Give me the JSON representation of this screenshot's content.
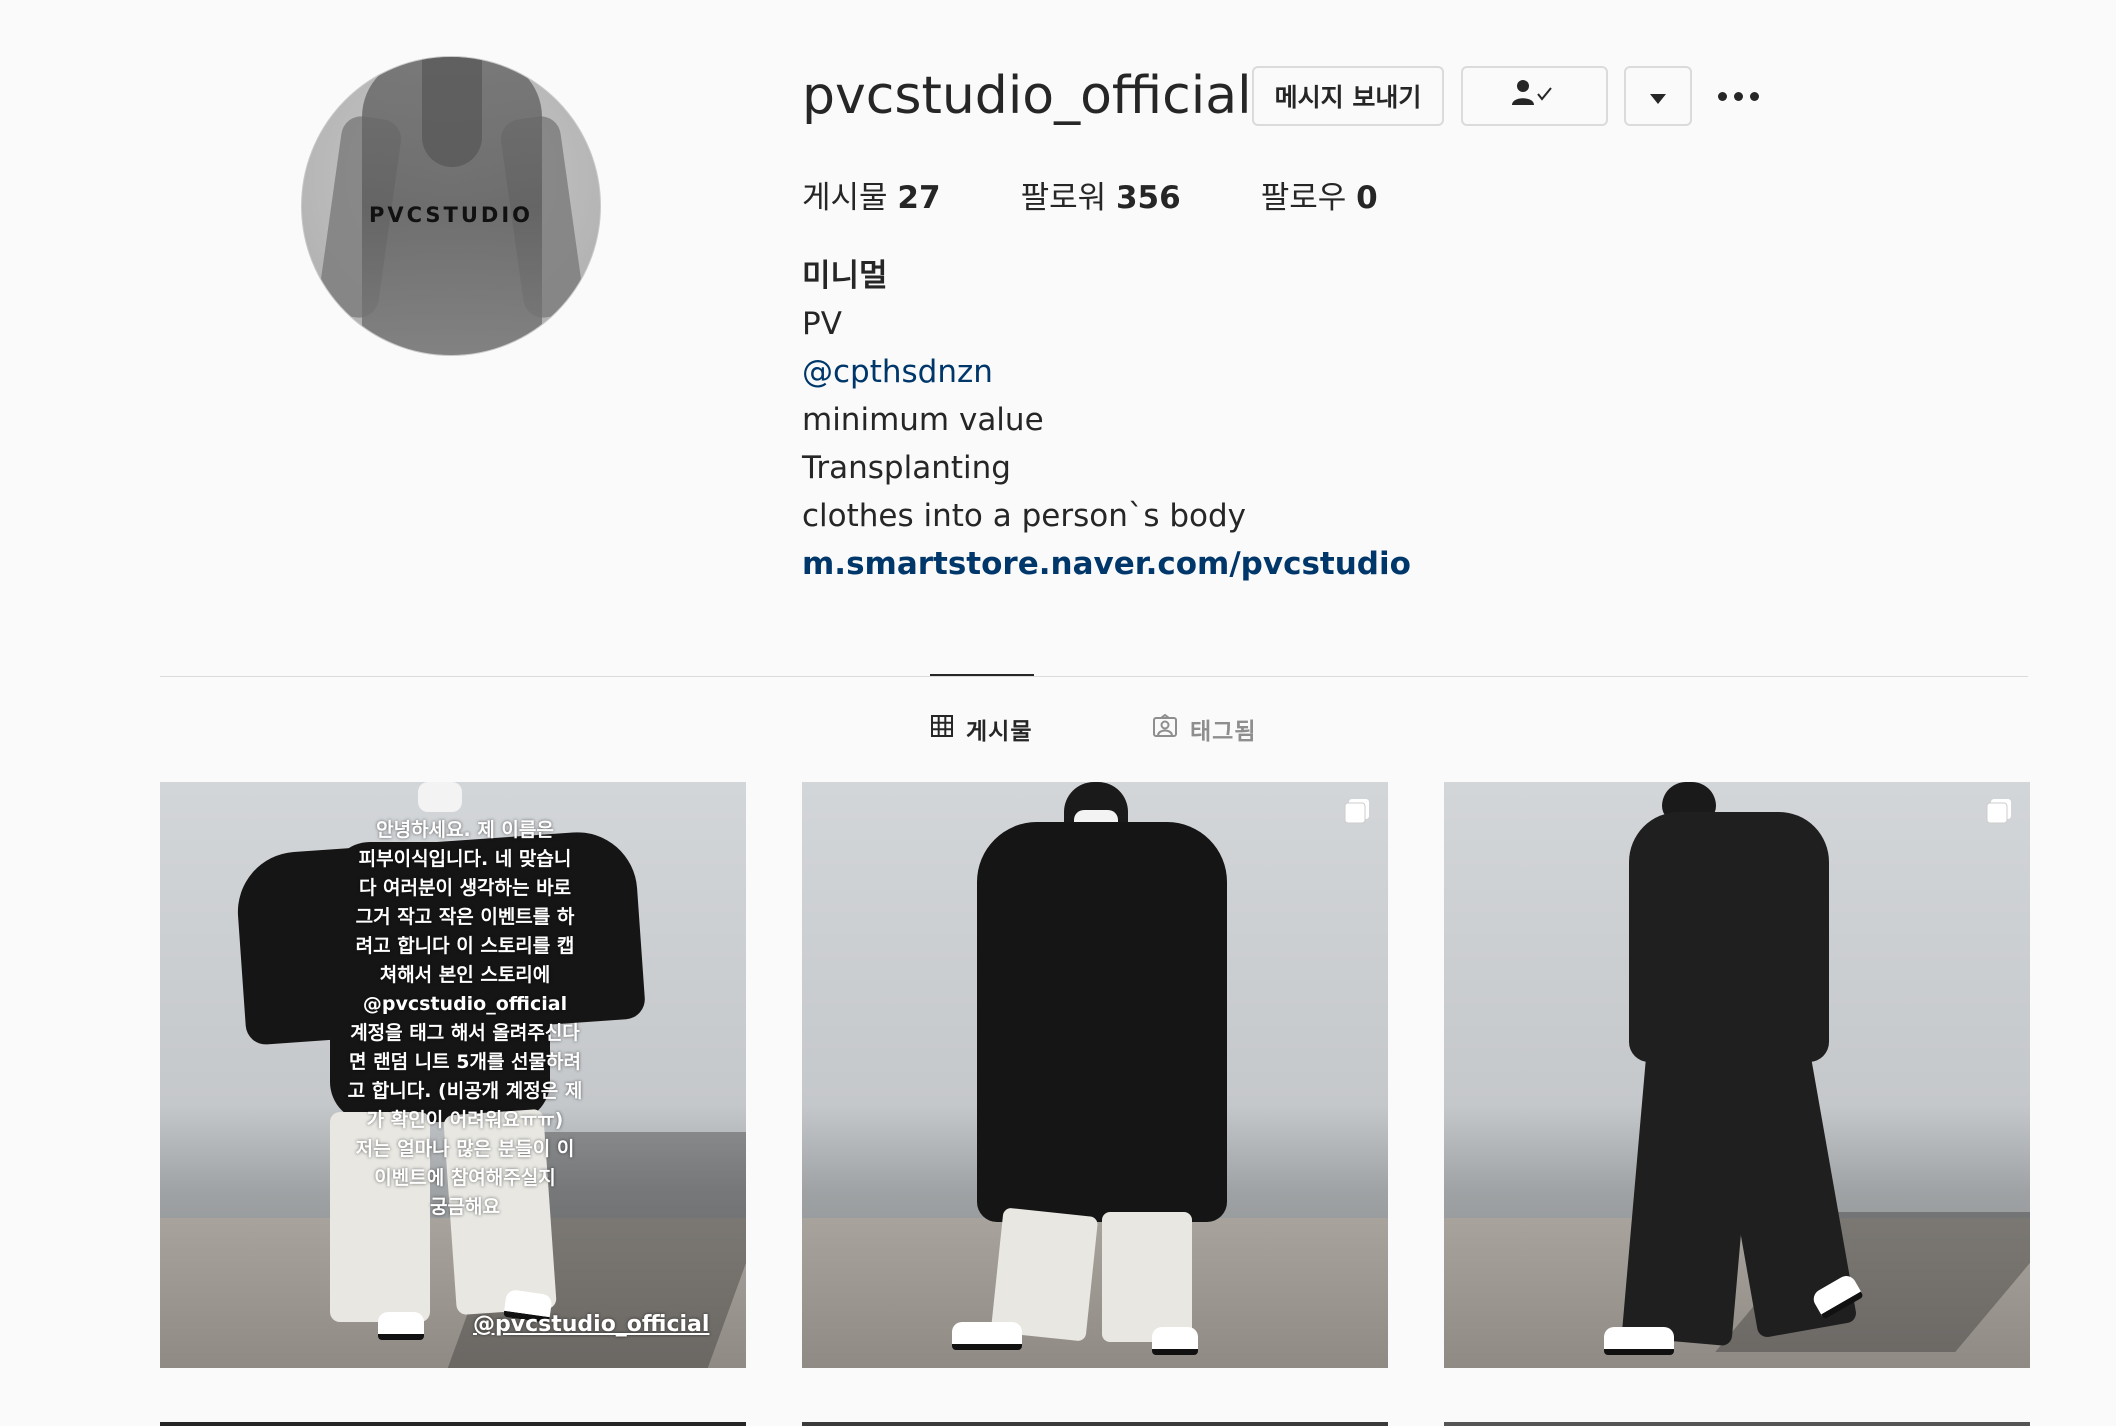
{
  "profile": {
    "username": "pvcstudio_official",
    "avatar_logo": "PVCSTUDIO",
    "message_button": "메시지 보내기",
    "follow_icon": "person-check-icon",
    "dropdown_icon": "caret-down-icon",
    "more_icon": "more-dots-icon"
  },
  "stats": [
    {
      "label": "게시물",
      "value": "27"
    },
    {
      "label": "팔로워",
      "value": "356"
    },
    {
      "label": "팔로우",
      "value": "0"
    }
  ],
  "bio": {
    "name": "미니멀",
    "lines": [
      "PV"
    ],
    "mention": "@cpthsdnzn",
    "text_lines": [
      "minimum value",
      "Transplanting",
      "clothes into a person`s body"
    ],
    "link": "m.smartstore.naver.com/pvcstudio"
  },
  "tabs": [
    {
      "label": "게시물",
      "icon": "grid-icon",
      "active": true
    },
    {
      "label": "태그됨",
      "icon": "tagged-icon",
      "active": false
    }
  ],
  "posts": [
    {
      "type": "story-graphic",
      "overlay_lines": [
        "안녕하세요. 제 이름은",
        "피부이식입니다. 네 맞습니",
        "다 여러분이 생각하는 바로",
        "그거 작고 작은 이벤트를 하",
        "려고 합니다 이 스토리를 캡",
        "쳐해서 본인 스토리에",
        "@pvcstudio_official",
        "계정을 태그 해서 올려주신다",
        "면 랜덤 니트 5개를 선물하려",
        "고 합니다. (비공개 계정은 제",
        "가 확인이 어려워요ㅠㅠ)",
        "저는 얼마나 많은 분들이 이",
        "이벤트에 참여해주실지",
        "궁금해요"
      ],
      "tag": "@pvcstudio_official"
    },
    {
      "type": "photo",
      "multi": true,
      "icon": "carousel-icon"
    },
    {
      "type": "photo",
      "multi": true,
      "icon": "carousel-icon"
    }
  ]
}
